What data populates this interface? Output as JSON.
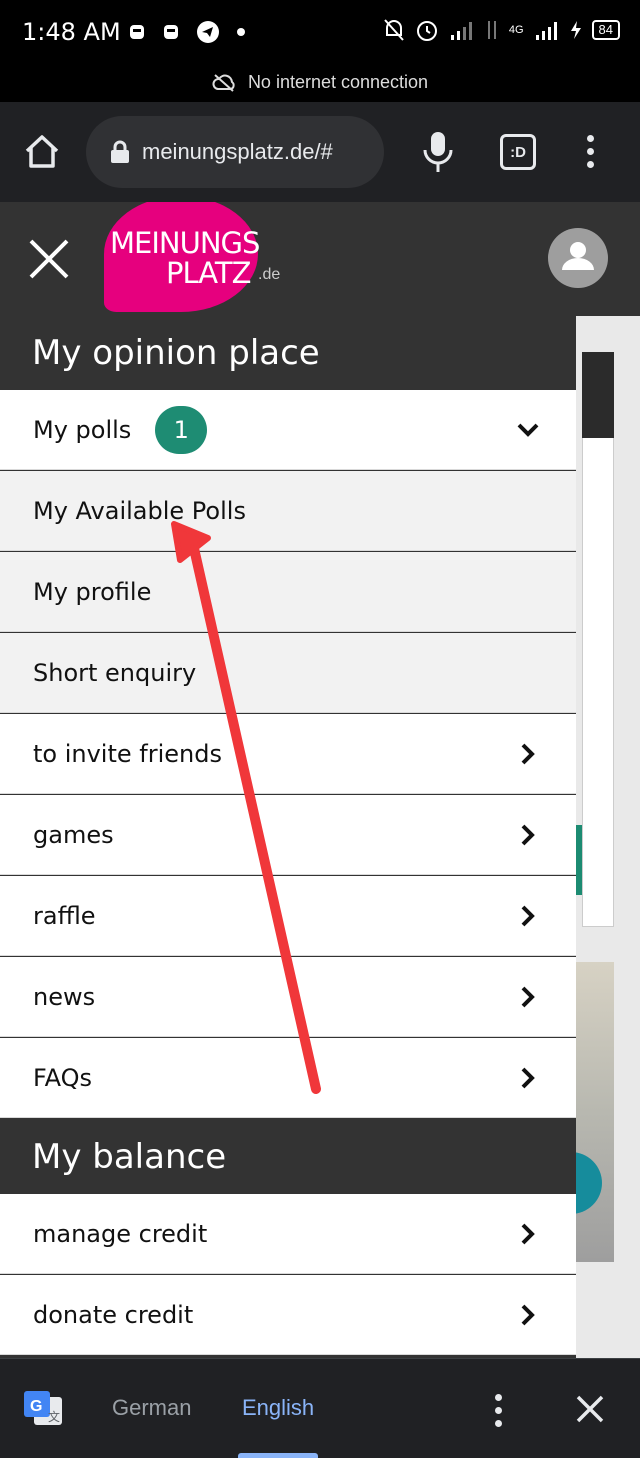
{
  "status_bar": {
    "time": "1:48 AM",
    "connection_message": "No internet connection",
    "network_label": "4G",
    "battery": "84"
  },
  "browser": {
    "url": "meinungsplatz.de/#",
    "tab_switcher_label": ":D"
  },
  "logo": {
    "line1": "MEINUNGS",
    "line2": "PLATZ",
    "suffix": ".de",
    "brand_color": "#e6007e"
  },
  "sections": {
    "opinion_title": "My opinion place",
    "balance_title": "My balance"
  },
  "menu": {
    "my_polls": "My polls",
    "my_polls_badge": "1",
    "available_polls": "My Available Polls",
    "my_profile": "My profile",
    "short_enquiry": "Short enquiry",
    "invite_friends": "to invite friends",
    "games": "games",
    "raffle": "raffle",
    "news": "news",
    "faqs": "FAQs",
    "manage_credit": "manage credit",
    "donate_credit": "donate credit"
  },
  "translate_bar": {
    "source_language": "German",
    "target_language": "English"
  },
  "colors": {
    "badge": "#1e8c73",
    "annotation_arrow": "#f0373a",
    "active_language": "#8ab4f8"
  }
}
